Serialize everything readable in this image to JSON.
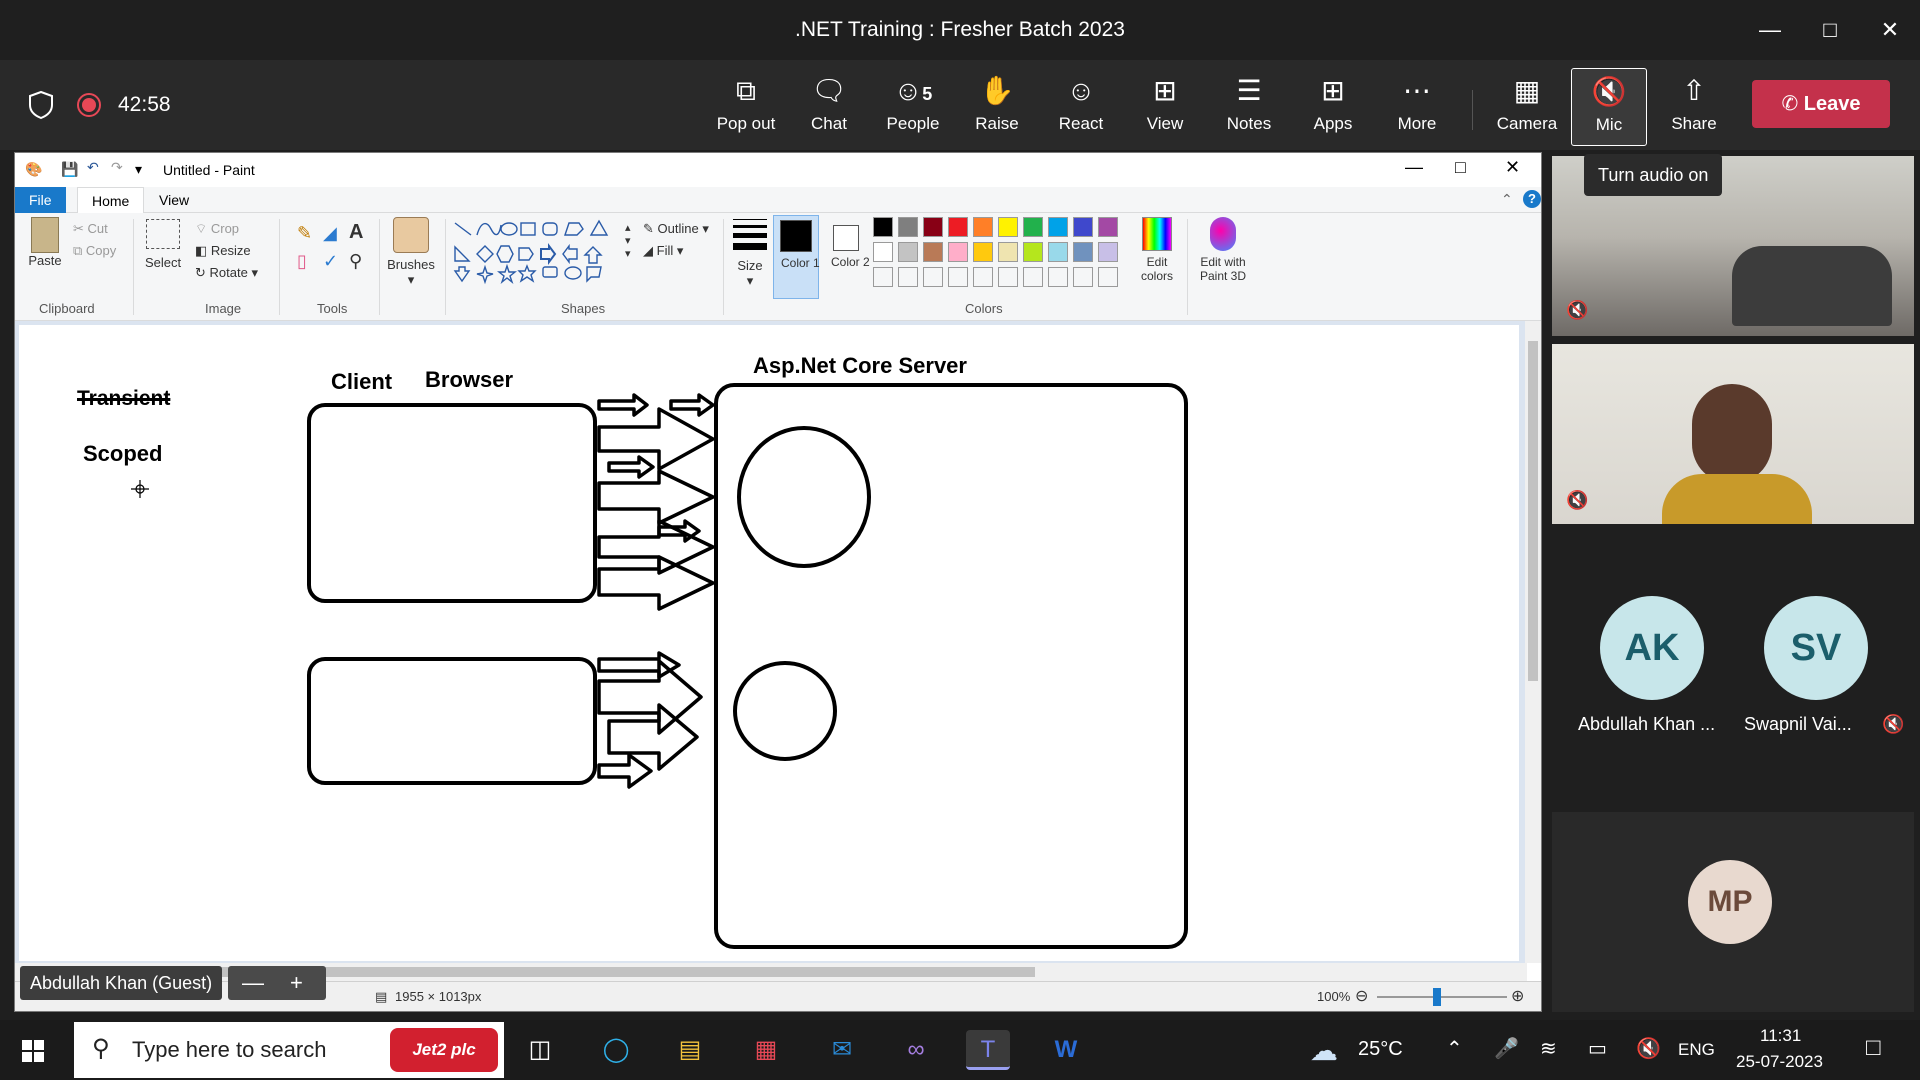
{
  "window": {
    "title": ".NET Training : Fresher Batch 2023"
  },
  "meeting": {
    "timer": "42:58",
    "buttons": [
      {
        "label": "Pop out",
        "icon": "pop-out-icon"
      },
      {
        "label": "Chat",
        "icon": "chat-icon"
      },
      {
        "label": "People",
        "icon": "people-icon",
        "count": "5"
      },
      {
        "label": "Raise",
        "icon": "raise-hand-icon"
      },
      {
        "label": "React",
        "icon": "react-icon"
      },
      {
        "label": "View",
        "icon": "view-icon"
      },
      {
        "label": "Notes",
        "icon": "notes-icon"
      },
      {
        "label": "Apps",
        "icon": "apps-icon"
      },
      {
        "label": "More",
        "icon": "more-icon"
      },
      {
        "label": "Camera",
        "icon": "camera-off-icon"
      },
      {
        "label": "Mic",
        "icon": "mic-off-icon"
      },
      {
        "label": "Share",
        "icon": "share-icon"
      }
    ],
    "leave_label": "Leave",
    "mic_tooltip": "Turn audio on",
    "leave_color": "#c4314b"
  },
  "paint": {
    "title": "Untitled - Paint",
    "tabs": [
      "File",
      "Home",
      "View"
    ],
    "clipboard": {
      "paste": "Paste",
      "cut": "Cut",
      "copy": "Copy",
      "label": "Clipboard"
    },
    "image": {
      "select": "Select",
      "crop": "Crop",
      "resize": "Resize",
      "rotate": "Rotate",
      "label": "Image"
    },
    "tools": {
      "label": "Tools"
    },
    "brushes": "Brushes",
    "shapes": {
      "label": "Shapes",
      "outline": "Outline",
      "fill": "Fill"
    },
    "size": "Size",
    "color1": "Color 1",
    "color2": "Color 2",
    "colors_label": "Colors",
    "edit_colors": "Edit colors",
    "edit_paint3d": "Edit with Paint 3D",
    "palette_row1": [
      "#000000",
      "#7f7f7f",
      "#880015",
      "#ed1c24",
      "#ff7f27",
      "#fff200",
      "#22b14c",
      "#00a2e8",
      "#3f48cc",
      "#a349a4"
    ],
    "palette_row2": [
      "#ffffff",
      "#c3c3c3",
      "#b97a57",
      "#ffaec9",
      "#ffc90e",
      "#efe4b0",
      "#b5e61d",
      "#99d9ea",
      "#7092be",
      "#c8bfe7"
    ],
    "canvas": {
      "text_transient": "Transient",
      "text_scoped": "Scoped",
      "text_client": "Client",
      "text_browser": "Browser",
      "text_server": "Asp.Net Core Server"
    },
    "status": {
      "dimensions": "1955 × 1013px",
      "zoom": "100%"
    }
  },
  "participants": {
    "presenter_label": "Abdullah Khan (Guest)",
    "avatars": [
      {
        "initials": "AK",
        "name": "Abdullah Khan ..."
      },
      {
        "initials": "SV",
        "name": "Swapnil Vai..."
      },
      {
        "initials": "MP",
        "name": ""
      }
    ]
  },
  "taskbar": {
    "search_placeholder": "Type here to search",
    "search_badge": "Jet2 plc",
    "weather": "25°C",
    "language": "ENG",
    "time": "11:31",
    "date": "25-07-2023"
  }
}
